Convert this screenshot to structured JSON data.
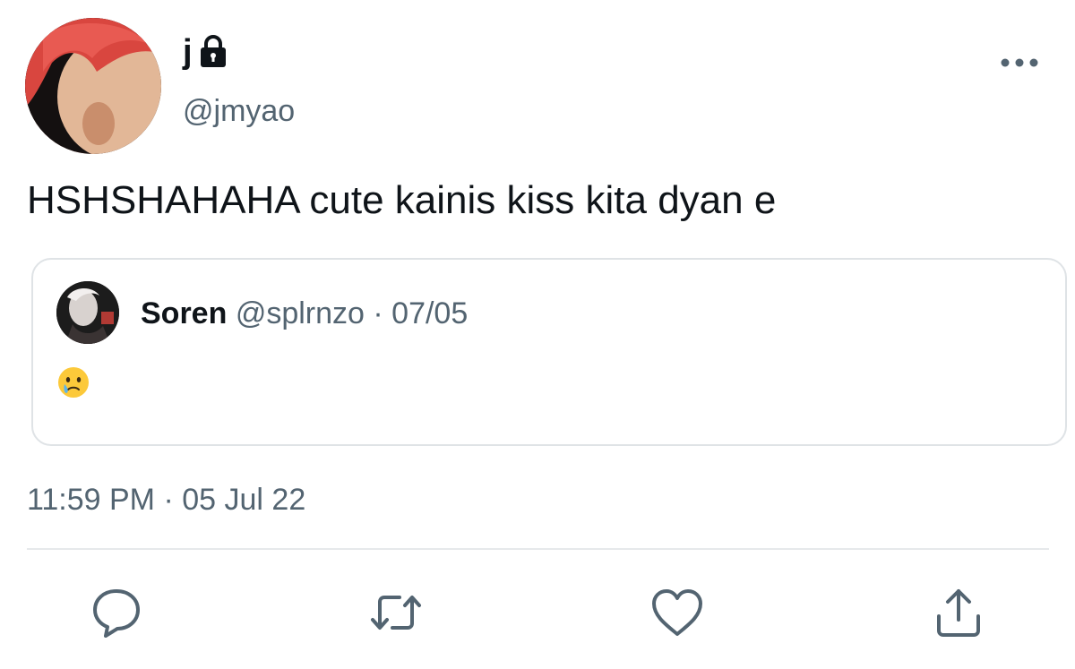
{
  "author": {
    "display_name": "j",
    "handle": "@jmyao",
    "protected_icon": "lock-icon",
    "avatar": "user-avatar"
  },
  "tweet": {
    "text": "HSHSHAHAHA cute kainis kiss kita dyan e",
    "time": "11:59 PM",
    "separator": "·",
    "date": "05 Jul 22"
  },
  "quoted_tweet": {
    "display_name": "Soren",
    "handle": "@splrnzo",
    "separator": "·",
    "date": "07/05",
    "content_emoji": "face-holding-back-tears-emoji"
  },
  "actions": {
    "reply": "reply-icon",
    "retweet": "retweet-icon",
    "like": "heart-icon",
    "share": "share-icon",
    "more": "more-options-icon"
  },
  "colors": {
    "primary_text": "#0f1419",
    "secondary_text": "#536471",
    "border": "#dfe3e6",
    "divider": "#e6e9eb",
    "background": "#ffffff"
  }
}
